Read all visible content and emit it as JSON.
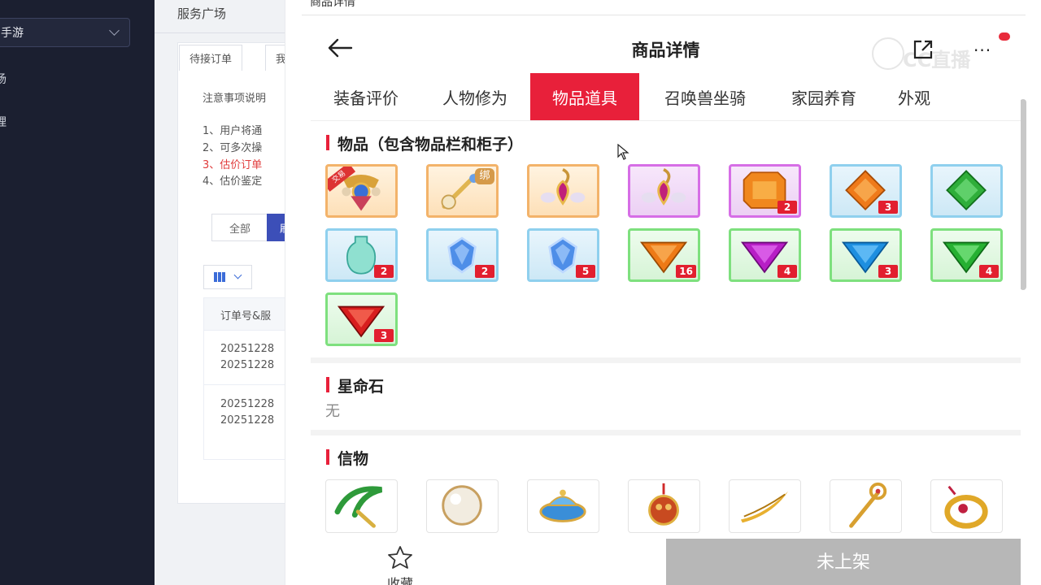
{
  "sidebar": {
    "select_label": "手游",
    "items": [
      {
        "label": "场"
      },
      {
        "label": "理"
      }
    ]
  },
  "admin": {
    "page_title": "服务广场",
    "tabs": [
      {
        "label": "待接订单"
      },
      {
        "label": "我"
      }
    ],
    "notice_title": "注意事项说明",
    "notice_lines": [
      "1、用户将通",
      "2、可多次操",
      "3、估价订单",
      "4、估价鉴定"
    ],
    "filter_all": "全部",
    "filter_active": "刷",
    "table_header": "订单号&服",
    "table_rows": [
      [
        "20251228",
        "20251228"
      ],
      [
        "20251228",
        "20251228"
      ]
    ]
  },
  "modal": {
    "header_text": "商品详情",
    "title": "商品详情",
    "watermark": "CC直播",
    "more_label": "···",
    "tabs": [
      {
        "label": "装备评价"
      },
      {
        "label": "人物修为"
      },
      {
        "label": "物品道具",
        "active": true
      },
      {
        "label": "召唤兽坐骑"
      },
      {
        "label": "家园养育"
      },
      {
        "label": "外观"
      }
    ],
    "sections": {
      "items": {
        "title": "物品（包含物品栏和柜子）",
        "cells": [
          {
            "icon": "ornate-pendant-icon",
            "frame": "orange",
            "count": "",
            "tag": "new",
            "tag_text": "交易"
          },
          {
            "icon": "jeweled-key-icon",
            "frame": "orange",
            "count": "",
            "tag": "bind",
            "tag_text": "绑"
          },
          {
            "icon": "amulet-pendant-icon",
            "frame": "orange",
            "count": ""
          },
          {
            "icon": "amulet-pendant-icon",
            "frame": "purple",
            "count": ""
          },
          {
            "icon": "orange-gem-icon",
            "frame": "purple",
            "count": "2"
          },
          {
            "icon": "orange-diamond-icon",
            "frame": "blue",
            "count": "3"
          },
          {
            "icon": "green-diamond-icon",
            "frame": "blue",
            "count": ""
          },
          {
            "icon": "jade-vase-icon",
            "frame": "blue",
            "count": "2"
          },
          {
            "icon": "blue-crystal-icon",
            "frame": "blue",
            "count": "2"
          },
          {
            "icon": "blue-crystal-icon",
            "frame": "blue",
            "count": "5"
          },
          {
            "icon": "orange-triangle-gem-icon",
            "frame": "green",
            "count": "16"
          },
          {
            "icon": "purple-triangle-gem-icon",
            "frame": "green",
            "count": "4"
          },
          {
            "icon": "blue-triangle-gem-icon",
            "frame": "green",
            "count": "3"
          },
          {
            "icon": "green-triangle-gem-icon",
            "frame": "green",
            "count": "4"
          },
          {
            "icon": "red-triangle-gem-icon",
            "frame": "green",
            "count": "3"
          }
        ]
      },
      "stars": {
        "title": "星命石",
        "value": "无"
      },
      "tokens": {
        "title": "信物",
        "cells": [
          {
            "icon": "jade-sickle-icon"
          },
          {
            "icon": "pearl-orb-icon"
          },
          {
            "icon": "treasure-bowl-icon"
          },
          {
            "icon": "charm-pouch-icon"
          },
          {
            "icon": "golden-feather-icon"
          },
          {
            "icon": "golden-scepter-icon"
          },
          {
            "icon": "jeweled-ring-icon"
          }
        ]
      }
    },
    "bottom": {
      "favorite_label": "收藏",
      "status_label": "未上架"
    }
  }
}
